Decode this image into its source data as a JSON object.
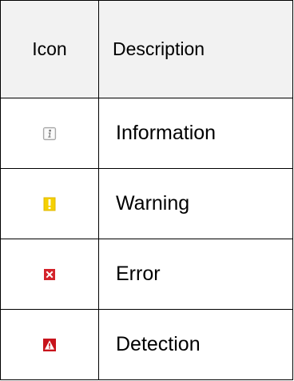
{
  "table": {
    "headers": {
      "icon": "Icon",
      "description": "Description"
    },
    "rows": [
      {
        "icon": "information-icon",
        "description": "Information"
      },
      {
        "icon": "warning-icon",
        "description": "Warning"
      },
      {
        "icon": "error-icon",
        "description": "Error"
      },
      {
        "icon": "detection-icon",
        "description": "Detection"
      }
    ]
  },
  "colors": {
    "header_background": "#f2f2f2",
    "border": "#000000",
    "info_icon_gray": "#9a9a9a",
    "warning_yellow": "#f5d000",
    "error_red": "#d4232b",
    "detection_red": "#c8141c"
  }
}
